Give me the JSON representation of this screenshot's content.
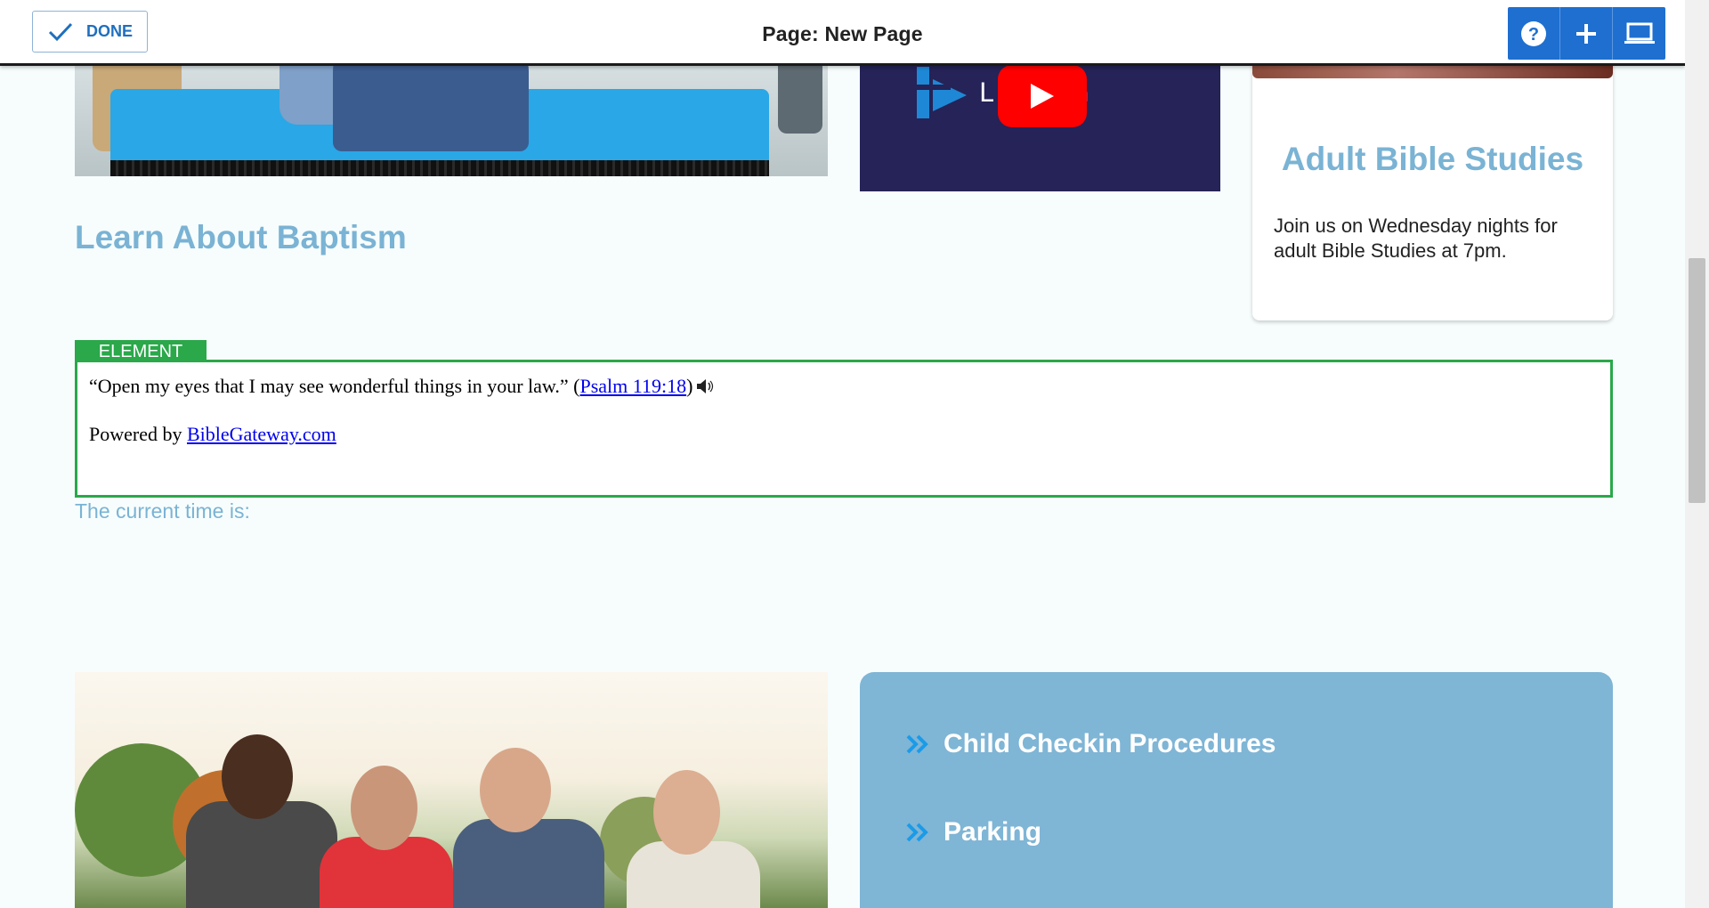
{
  "editor": {
    "done_label": "DONE",
    "page_title": "Page: New Page",
    "tools": [
      "help-icon",
      "plus-icon",
      "laptop-icon"
    ]
  },
  "video": {
    "channel_text": "L        church",
    "logo": "church-logo-icon",
    "play": "youtube-play-icon"
  },
  "bible_card": {
    "title": "Adult Bible Studies",
    "text": "Join us on Wednesday nights for adult Bible Studies at 7pm."
  },
  "baptism": {
    "heading": "Learn About Baptism"
  },
  "element": {
    "tag": "ELEMENT",
    "verse_text": "“Open my eyes that I may see wonderful things in your law.” (",
    "verse_ref": "Psalm 119:18",
    "verse_close": ")",
    "powered_by": "Powered by ",
    "powered_link": "BibleGateway.com"
  },
  "clock": {
    "label": "The current time is:"
  },
  "links": [
    {
      "label": "Child Checkin Procedures",
      "icon": "double-chevron-right-icon"
    },
    {
      "label": "Parking",
      "icon": "double-chevron-right-icon"
    }
  ],
  "colors": {
    "accent_blue": "#7ab3d4",
    "editor_blue": "#1e6fd0",
    "element_green": "#2aa84a",
    "video_bg": "#252357",
    "links_bg": "#7fb5d5",
    "arrow_blue": "#1a9be8"
  }
}
